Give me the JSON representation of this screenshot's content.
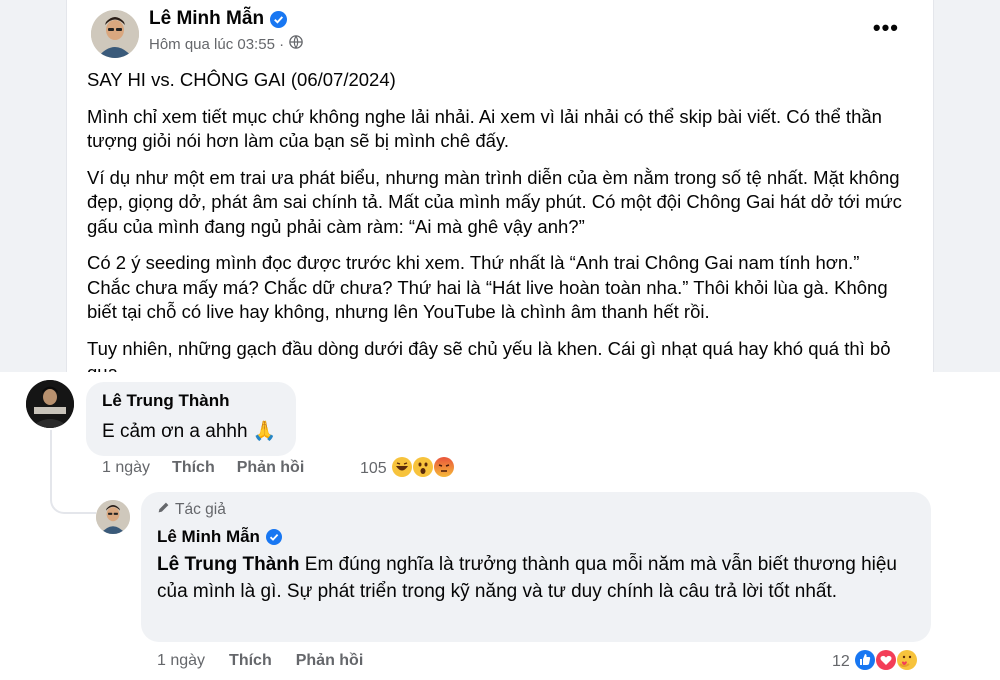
{
  "post": {
    "author": "Lê Minh Mẫn",
    "timestamp": "Hôm qua lúc 03:55 ·",
    "privacy_icon": "globe-icon",
    "more_icon": "more-icon",
    "title": "SAY HI vs. CHÔNG GAI (06/07/2024)",
    "paragraphs": [
      "Mình chỉ xem tiết mục chứ không nghe lải nhải. Ai xem vì lải nhải có thể skip bài viết. Có thể thần tượng giỏi nói hơn làm của bạn sẽ bị mình chê đấy.",
      "Ví dụ như một em trai ưa phát biểu, nhưng màn trình diễn của èm nằm trong số tệ nhất. Mặt không đẹp, giọng dở, phát âm sai chính tả. Mất của mình mấy phút. Có một đội Chông Gai hát dở tới mức gấu của mình đang ngủ phải càm ràm: “Ai mà ghê vậy anh?”",
      "Có 2 ý seeding mình đọc được trước khi xem. Thứ nhất là “Anh trai Chông Gai nam tính hơn.” Chắc chưa mấy má? Chắc dữ chưa? Thứ hai là “Hát live hoàn toàn nha.” Thôi khỏi lùa gà. Không biết tại chỗ có live hay không, nhưng lên YouTube là chình âm thanh hết rồi.",
      "Tuy nhiên, những gạch đầu dòng dưới đây sẽ chủ yếu là khen. Cái gì nhạt quá hay khó quá thì bỏ qua."
    ]
  },
  "comment1": {
    "author": "Lê Trung Thành",
    "text": "E cảm ơn a ahhh 🙏",
    "time": "1 ngày",
    "like_label": "Thích",
    "reply_label": "Phản hồi",
    "reaction_count": "105",
    "reactions": [
      "haha",
      "wow",
      "angry"
    ]
  },
  "comment2": {
    "author_tag": "Tác giả",
    "author": "Lê Minh Mẫn",
    "mention": "Lê Trung Thành",
    "text": " Em đúng nghĩa là trưởng thành qua mỗi năm mà vẫn biết thương hiệu của mình là gì. Sự phát triển trong kỹ năng và tư duy chính là câu trả lời tốt nhất.",
    "time": "1 ngày",
    "like_label": "Thích",
    "reply_label": "Phản hồi",
    "reaction_count": "12",
    "reactions": [
      "like",
      "love",
      "care"
    ]
  },
  "colors": {
    "facebook_blue": "#1877f2",
    "muted_text": "#65676b",
    "bubble_bg": "#f0f2f5"
  }
}
